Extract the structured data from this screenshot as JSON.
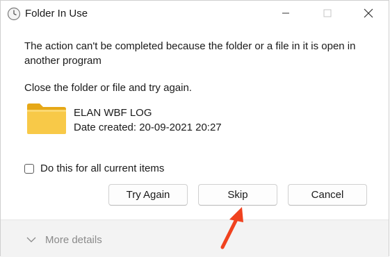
{
  "window": {
    "title": "Folder In Use",
    "title_icon": "clock-icon",
    "controls": [
      "minimize-icon",
      "maximize-icon",
      "close-icon"
    ]
  },
  "message": {
    "text": "The action can't be completed because the folder or a file in it is open in another program",
    "instruction": "Close the folder or file and try again."
  },
  "file": {
    "icon": "folder-icon",
    "name": "ELAN WBF LOG",
    "date_created": "Date created: 20-09-2021 20:27"
  },
  "checkbox": {
    "label": "Do this for all current items",
    "checked": false
  },
  "buttons": {
    "try_again": "Try Again",
    "skip": "Skip",
    "cancel": "Cancel"
  },
  "footer": {
    "more_details": "More details",
    "chevron_icon": "chevron-down-icon"
  },
  "colors": {
    "folder_yellow": "#f8c948",
    "arrow_red": "#f0421f",
    "footer_bg": "#f3f3f3"
  }
}
